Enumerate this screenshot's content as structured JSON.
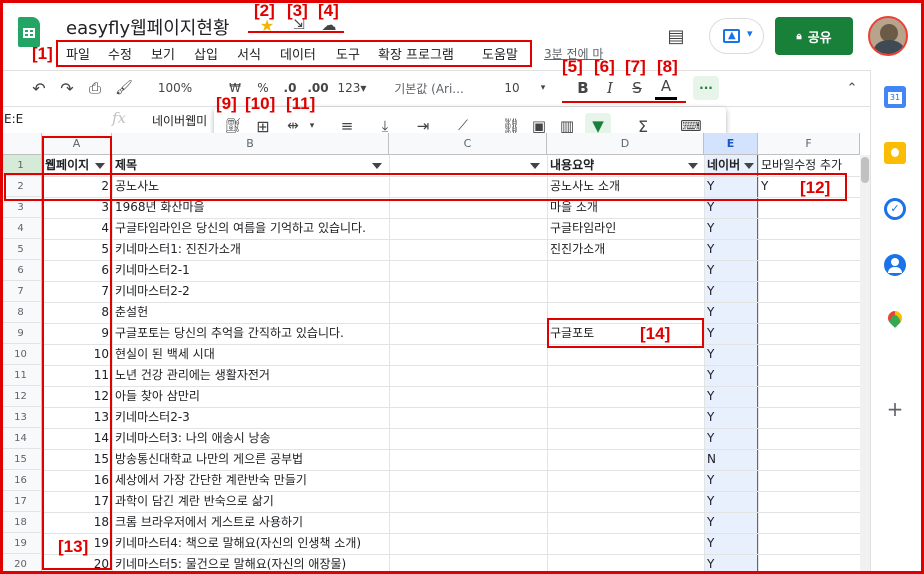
{
  "app": {
    "title": "easyfly웹페이지현황",
    "last_edit": "3분 전에 마"
  },
  "menu": [
    "파일",
    "수정",
    "보기",
    "삽입",
    "서식",
    "데이터",
    "도구",
    "확장 프로그램",
    "도움말"
  ],
  "header": {
    "share_label": "공유",
    "present_arrow": "▾",
    "comment_icon": "comment-icon"
  },
  "toolbar": {
    "zoom": "100%",
    "currency": "₩",
    "percent": "%",
    "dec_less": ".0",
    "dec_more": ".00",
    "more_formats": "123▾",
    "font": "기본값 (Ari...",
    "font_size": "10",
    "bold": "B",
    "italic": "I",
    "strike": "S",
    "text_color": "A",
    "more": "···"
  },
  "formula": {
    "cell_ref": "E:E",
    "fx": "fx",
    "content": "네이버웹미"
  },
  "columns": [
    {
      "id": "A",
      "label": "A"
    },
    {
      "id": "B",
      "label": "B"
    },
    {
      "id": "C",
      "label": "C"
    },
    {
      "id": "D",
      "label": "D"
    },
    {
      "id": "E",
      "label": "E"
    },
    {
      "id": "F",
      "label": "F"
    }
  ],
  "header_row": {
    "a": "웹페이지",
    "b": "제목",
    "d": "내용요약",
    "e": "네이버",
    "f": "모바일수정 추가"
  },
  "rows": [
    {
      "n": "2",
      "a": "2",
      "b": "공노사노",
      "d": "공노사노 소개",
      "e": "Y",
      "f": "Y"
    },
    {
      "n": "3",
      "a": "3",
      "b": "1968년 화산마을",
      "d": "마을 소개",
      "e": "Y",
      "f": ""
    },
    {
      "n": "4",
      "a": "4",
      "b": "구글타임라인은 당신의 여름을 기억하고 있습니다.",
      "d": "구글타임라인",
      "e": "Y",
      "f": ""
    },
    {
      "n": "5",
      "a": "5",
      "b": "키네마스터1: 진진가소개",
      "d": "진진가소개",
      "e": "Y",
      "f": ""
    },
    {
      "n": "6",
      "a": "6",
      "b": "키네마스터2-1",
      "d": "",
      "e": "Y",
      "f": ""
    },
    {
      "n": "7",
      "a": "7",
      "b": "키네마스터2-2",
      "d": "",
      "e": "Y",
      "f": ""
    },
    {
      "n": "8",
      "a": "8",
      "b": "춘설헌",
      "d": "",
      "e": "Y",
      "f": ""
    },
    {
      "n": "9",
      "a": "9",
      "b": "구글포토는 당신의 추억을 간직하고 있습니다.",
      "d": "구글포토",
      "e": "Y",
      "f": ""
    },
    {
      "n": "10",
      "a": "10",
      "b": "현실이 된 백세 시대",
      "d": "",
      "e": "Y",
      "f": ""
    },
    {
      "n": "11",
      "a": "11",
      "b": "노년 건강 관리에는 생활자전거",
      "d": "",
      "e": "Y",
      "f": ""
    },
    {
      "n": "12",
      "a": "12",
      "b": "아들 찾아 삼만리",
      "d": "",
      "e": "Y",
      "f": ""
    },
    {
      "n": "13",
      "a": "13",
      "b": "키네마스터2-3",
      "d": "",
      "e": "Y",
      "f": ""
    },
    {
      "n": "14",
      "a": "14",
      "b": "키네마스터3: 나의 애송시 낭송",
      "d": "",
      "e": "Y",
      "f": ""
    },
    {
      "n": "15",
      "a": "15",
      "b": "방송통신대학교 나만의 게으른 공부법",
      "d": "",
      "e": "N",
      "f": ""
    },
    {
      "n": "16",
      "a": "16",
      "b": "세상에서 가장 간단한 계란반숙 만들기",
      "d": "",
      "e": "Y",
      "f": ""
    },
    {
      "n": "17",
      "a": "17",
      "b": "과학이 담긴 계란 반숙으로 삶기",
      "d": "",
      "e": "Y",
      "f": ""
    },
    {
      "n": "18",
      "a": "18",
      "b": "크롬 브라우저에서 게스트로 사용하기",
      "d": "",
      "e": "Y",
      "f": ""
    },
    {
      "n": "19",
      "a": "19",
      "b": "키네마스터4: 책으로 말해요(자신의 인생책 소개)",
      "d": "",
      "e": "Y",
      "f": ""
    },
    {
      "n": "20",
      "a": "20",
      "b": "키네마스터5: 물건으로 말해요(자신의 애장물)",
      "d": "",
      "e": "Y",
      "f": ""
    }
  ],
  "header_row_num": "1",
  "annotations": {
    "n1": "[1]",
    "n2": "[2]",
    "n3": "[3]",
    "n4": "[4]",
    "n5": "[5]",
    "n6": "[6]",
    "n7": "[7]",
    "n8": "[8]",
    "n9": "[9]",
    "n10": "[10]",
    "n11": "[11]",
    "n12": "[12]",
    "n13": "[13]",
    "n14": "[14]"
  },
  "colors": {
    "accent_green": "#188038",
    "selection_blue": "#e8f0fe",
    "annotation_red": "#e00000"
  }
}
